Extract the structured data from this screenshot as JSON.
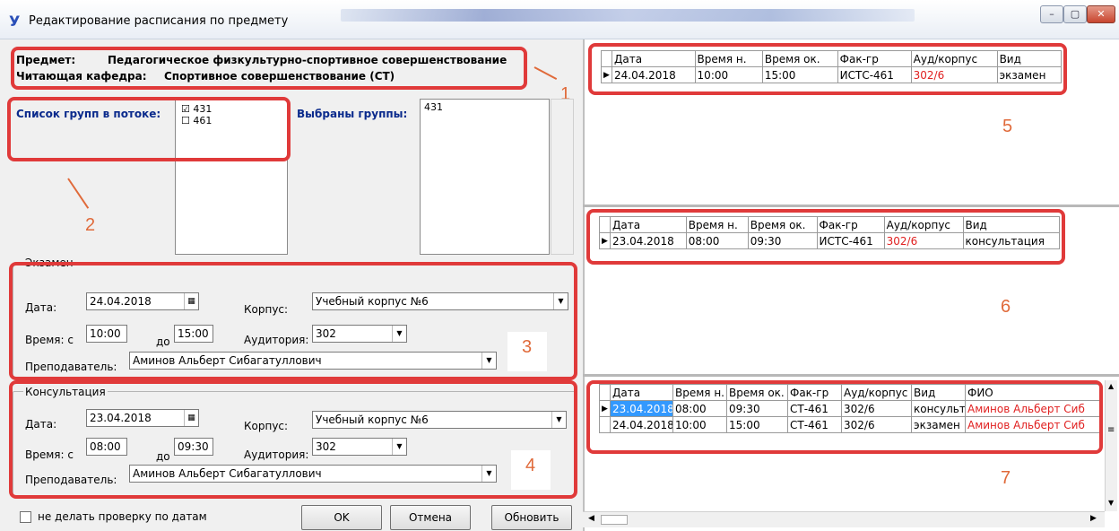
{
  "window": {
    "title": "Редактирование расписания по предмету",
    "app_icon_glyph": "У",
    "controls": {
      "min": "–",
      "max": "▢",
      "close": "✕"
    }
  },
  "subject": {
    "subject_label": "Предмет:",
    "subject_value": "Педагогическое физкультурно-спортивное совершенствование",
    "dept_label": "Читающая кафедра:",
    "dept_value": "Спортивное совершенствование (СТ)"
  },
  "groups": {
    "stream_label": "Список групп в потоке:",
    "stream_groups": [
      {
        "name": "431",
        "checked": true
      },
      {
        "name": "461",
        "checked": false
      }
    ],
    "selected_label": "Выбраны группы:",
    "selected_value": "431"
  },
  "exam": {
    "legend": "Экзамен",
    "date_label": "Дата:",
    "date_value": "24.04.2018",
    "building_label": "Корпус:",
    "building_value": "Учебный корпус №6",
    "time_label": "Время:  с",
    "time_from": "10:00",
    "to_label": "до",
    "time_to": "15:00",
    "room_label": "Аудитория:",
    "room_value": "302",
    "teacher_label": "Преподаватель:",
    "teacher_value": "Аминов Альберт Сибагатуллович"
  },
  "consult": {
    "legend": "Консультация",
    "date_label": "Дата:",
    "date_value": "23.04.2018",
    "building_label": "Корпус:",
    "building_value": "Учебный корпус №6",
    "time_label": "Время:  с",
    "time_from": "08:00",
    "to_label": "до",
    "time_to": "09:30",
    "room_label": "Аудитория:",
    "room_value": "302",
    "teacher_label": "Преподаватель:",
    "teacher_value": "Аминов Альберт Сибагатуллович"
  },
  "footer": {
    "nocheck_label": "не делать проверку по датам",
    "ok": "OK",
    "cancel": "Отмена",
    "refresh": "Обновить"
  },
  "annotations": [
    "1",
    "2",
    "3",
    "4",
    "5",
    "6",
    "7"
  ],
  "grid5": {
    "headers": [
      "Дата",
      "Время н.",
      "Время ок.",
      "Фак-гр",
      "Ауд/корпус",
      "Вид"
    ],
    "rows": [
      [
        "24.04.2018",
        "10:00",
        "15:00",
        "ИСТС-461",
        "302/6",
        "экзамен"
      ]
    ]
  },
  "grid6": {
    "headers": [
      "Дата",
      "Время н.",
      "Время ок.",
      "Фак-гр",
      "Ауд/корпус",
      "Вид"
    ],
    "rows": [
      [
        "23.04.2018",
        "08:00",
        "09:30",
        "ИСТС-461",
        "302/6",
        "консультация"
      ]
    ]
  },
  "grid7": {
    "headers": [
      "Дата",
      "Время н.",
      "Время ок.",
      "Фак-гр",
      "Ауд/корпус",
      "Вид",
      "ФИО"
    ],
    "rows": [
      [
        "23.04.2018",
        "08:00",
        "09:30",
        "СТ-461",
        "302/6",
        "консульт",
        "Аминов Альберт Сиб"
      ],
      [
        "24.04.2018",
        "10:00",
        "15:00",
        "СТ-461",
        "302/6",
        "экзамен",
        "Аминов Альберт Сиб"
      ]
    ]
  },
  "colors": {
    "highlight_box": "#e03a3a",
    "annotation": "#e06a3a",
    "selection": "#3399ff",
    "red_text": "#e02020"
  }
}
